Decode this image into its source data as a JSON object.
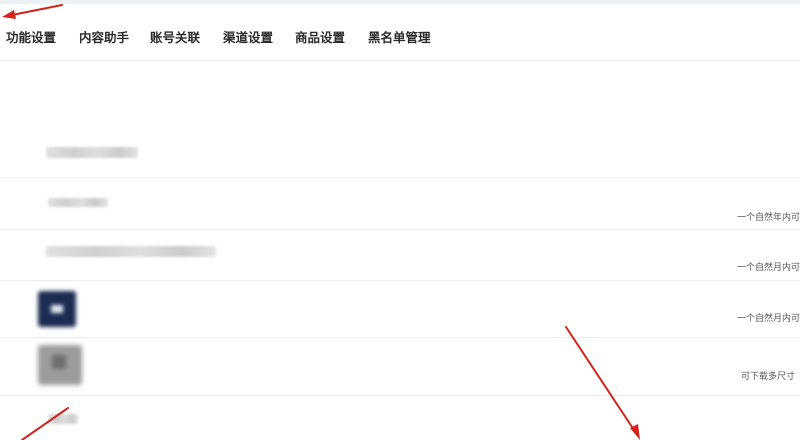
{
  "tabs": [
    {
      "label": "功能设置"
    },
    {
      "label": "内容助手"
    },
    {
      "label": "账号关联"
    },
    {
      "label": "渠道设置"
    },
    {
      "label": "商品设置"
    },
    {
      "label": "黑名单管理"
    }
  ],
  "rows": {
    "note_1": "一个自然年内可",
    "note_2": "一个自然月内可",
    "note_3": "一个自然月内可",
    "note_4": "可下载多尺寸"
  },
  "colors": {
    "annotation_arrow": "#d2231c",
    "dark_thumbnail": "#1b2b52"
  }
}
